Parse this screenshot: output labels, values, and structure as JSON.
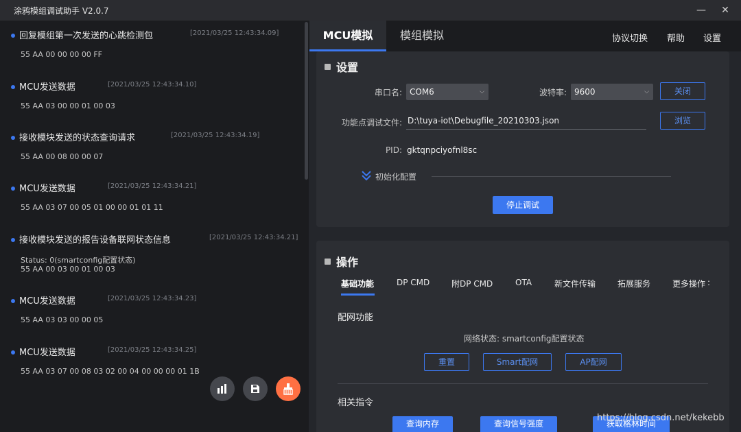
{
  "window": {
    "title": "涂鸦模组调试助手 V2.0.7",
    "minimize_glyph": "—",
    "close_glyph": "✕"
  },
  "log": [
    {
      "title": "回复模组第一次发送的心跳检测包",
      "timestamp": "[2021/03/25 12:43:34.09]",
      "lines": [
        "55 AA 00 00 00 00 FF"
      ]
    },
    {
      "title": "MCU发送数据",
      "timestamp": "[2021/03/25 12:43:34.10]",
      "lines": [
        "55 AA 03 00 00 01 00 03"
      ]
    },
    {
      "title": "接收模块发送的状态查询请求",
      "timestamp": "[2021/03/25 12:43:34.19]",
      "lines": [
        "55 AA 00 08 00 00 07"
      ]
    },
    {
      "title": "MCU发送数据",
      "timestamp": "[2021/03/25 12:43:34.21]",
      "lines": [
        "55 AA 03 07 00 05 01 00 00 01 01 11"
      ]
    },
    {
      "title": "接收模块发送的报告设备联网状态信息",
      "timestamp": "[2021/03/25 12:43:34.21]",
      "lines": [
        "Status: 0(smartconfig配置状态)",
        "55 AA 00 03 00 01 00 03"
      ]
    },
    {
      "title": "MCU发送数据",
      "timestamp": "[2021/03/25 12:43:34.23]",
      "lines": [
        "55 AA 03 03 00 00 05"
      ]
    },
    {
      "title": "MCU发送数据",
      "timestamp": "[2021/03/25 12:43:34.25]",
      "lines": [
        "55 AA 03 07 00 08 03 02 00 04 00 00 00 01 1B"
      ]
    }
  ],
  "fabs": {
    "chart_icon": "bar-chart-icon",
    "save_icon": "save-icon",
    "clear_icon": "broom-icon"
  },
  "tabs": {
    "mcu": "MCU模拟",
    "module": "模组模拟"
  },
  "nav": {
    "protocol": "协议切换",
    "help": "帮助",
    "settings": "设置"
  },
  "settings": {
    "title": "设置",
    "port_label": "串口名:",
    "port_value": "COM6",
    "baud_label": "波特率:",
    "baud_value": "9600",
    "close_btn": "关闭",
    "file_label": "功能点调试文件:",
    "file_value": "D:\\tuya-iot\\Debugfile_20210303.json",
    "browse_btn": "浏览",
    "pid_label": "PID:",
    "pid_value": "gktqnpciyofnl8sc",
    "init_label": "初始化配置",
    "stop_btn": "停止调试"
  },
  "operations": {
    "title": "操作",
    "subtabs": [
      "基础功能",
      "DP CMD",
      "附DP CMD",
      "OTA",
      "新文件传输",
      "拓展服务",
      "更多操作"
    ],
    "more_indicator": ":",
    "network_title": "配网功能",
    "network_status": "网络状态: smartconfig配置状态",
    "reset_btn": "重置",
    "smart_btn": "Smart配网",
    "ap_btn": "AP配网",
    "related_title": "相关指令",
    "partial_btns": [
      "查询内存",
      "查询信号强度",
      "获取格林时间"
    ]
  },
  "watermark": "https://blog.csdn.net/kekebb",
  "colors": {
    "accent": "#3c78f0",
    "orange": "#ff7043"
  }
}
